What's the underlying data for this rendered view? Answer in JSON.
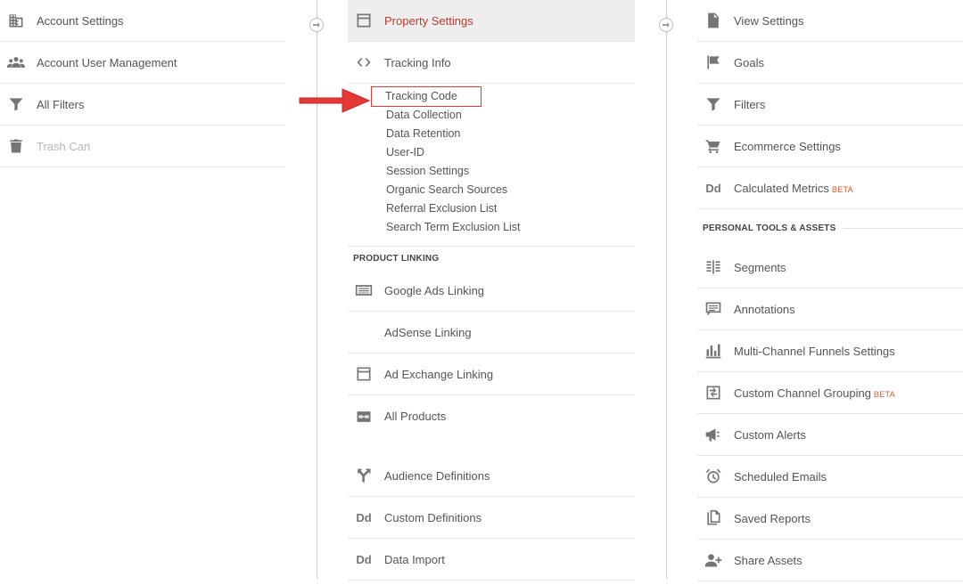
{
  "account": {
    "items": [
      {
        "label": "Account Settings",
        "icon": "building-icon",
        "disabled": false
      },
      {
        "label": "Account User Management",
        "icon": "users-icon",
        "disabled": false
      },
      {
        "label": "All Filters",
        "icon": "filter-icon",
        "disabled": false
      },
      {
        "label": "Trash Can",
        "icon": "trash-icon",
        "disabled": true
      }
    ]
  },
  "property": {
    "settings_label": "Property Settings",
    "tracking_info_label": "Tracking Info",
    "tracking_sub": [
      "Tracking Code",
      "Data Collection",
      "Data Retention",
      "User-ID",
      "Session Settings",
      "Organic Search Sources",
      "Referral Exclusion List",
      "Search Term Exclusion List"
    ],
    "product_linking_heading": "PRODUCT LINKING",
    "linking": [
      {
        "label": "Google Ads Linking",
        "icon": "ads-icon"
      },
      {
        "label": "AdSense Linking",
        "icon": ""
      },
      {
        "label": "Ad Exchange Linking",
        "icon": "window-icon"
      },
      {
        "label": "All Products",
        "icon": "link-icon"
      }
    ],
    "bottom": [
      {
        "label": "Audience Definitions",
        "icon": "fork-icon"
      },
      {
        "label": "Custom Definitions",
        "icon": "dd-icon",
        "icon_text": "Dd"
      },
      {
        "label": "Data Import",
        "icon": "dd-icon",
        "icon_text": "Dd"
      }
    ]
  },
  "view": {
    "top": [
      {
        "label": "View Settings",
        "icon": "document-icon"
      },
      {
        "label": "Goals",
        "icon": "flag-icon"
      },
      {
        "label": "Filters",
        "icon": "filter-icon"
      },
      {
        "label": "Ecommerce Settings",
        "icon": "cart-icon"
      },
      {
        "label": "Calculated Metrics",
        "icon": "dd-icon",
        "icon_text": "Dd",
        "badge": "BETA"
      }
    ],
    "personal_heading": "PERSONAL TOOLS & ASSETS",
    "personal": [
      {
        "label": "Segments",
        "icon": "segments-icon"
      },
      {
        "label": "Annotations",
        "icon": "comment-icon"
      },
      {
        "label": "Multi-Channel Funnels Settings",
        "icon": "bars-icon"
      },
      {
        "label": "Custom Channel Grouping",
        "icon": "grouping-icon",
        "badge": "BETA"
      },
      {
        "label": "Custom Alerts",
        "icon": "megaphone-icon"
      },
      {
        "label": "Scheduled Emails",
        "icon": "alarm-icon"
      },
      {
        "label": "Saved Reports",
        "icon": "copy-icon"
      },
      {
        "label": "Share Assets",
        "icon": "add-user-icon"
      }
    ]
  },
  "colors": {
    "active_text": "#c53929",
    "highlight_box": "#e53935",
    "arrow": "#e53935",
    "beta": "#e05a2c"
  }
}
